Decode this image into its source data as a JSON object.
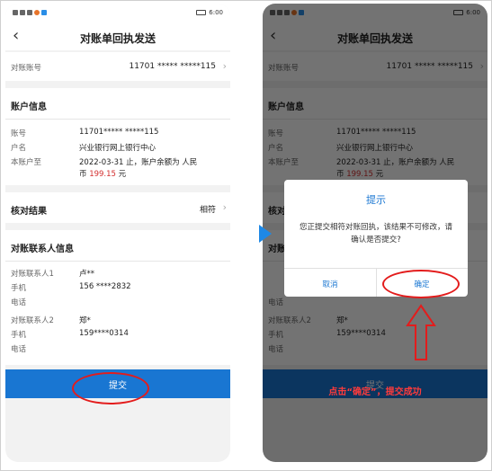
{
  "status": {
    "time": "6:00"
  },
  "nav": {
    "title": "对账单回执发送",
    "back": "‹"
  },
  "account_row": {
    "label": "对账账号",
    "value": "11701 ***** *****115"
  },
  "account_info": {
    "title": "账户信息",
    "rows": [
      {
        "label": "账号",
        "value": "11701***** *****115"
      },
      {
        "label": "户名",
        "value": "兴业银行网上银行中心"
      },
      {
        "label": "本账户至",
        "value_line1": "2022-03-31 止，账户余额为 人民",
        "value_line2_prefix": "币 ",
        "amount": "199.15",
        "value_line2_suffix": " 元"
      }
    ]
  },
  "check_result": {
    "label": "核对结果",
    "value": "相符"
  },
  "contacts": {
    "title": "对账联系人信息",
    "rows": [
      {
        "label": "对账联系人1",
        "value": "卢**"
      },
      {
        "label": "手机",
        "value": "156 ****2832"
      },
      {
        "label": "电话",
        "value": ""
      },
      {
        "label": "对账联系人2",
        "value": "郑*"
      },
      {
        "label": "手机",
        "value": "159****0314"
      },
      {
        "label": "电话",
        "value": ""
      }
    ]
  },
  "submit": {
    "label": "提交"
  },
  "dialog": {
    "title": "提示",
    "message": "您正提交相符对账回执，该结果不可修改，请确认是否提交?",
    "cancel": "取消",
    "confirm": "确定"
  },
  "caption": "点击“确定”，提交成功",
  "colors": {
    "accent": "#1976d2",
    "annotation": "#e31c1c",
    "amount": "#d32f2f"
  },
  "icons": [
    "back-chevron-icon",
    "chevron-right-icon",
    "battery-icon",
    "up-arrow-icon"
  ]
}
